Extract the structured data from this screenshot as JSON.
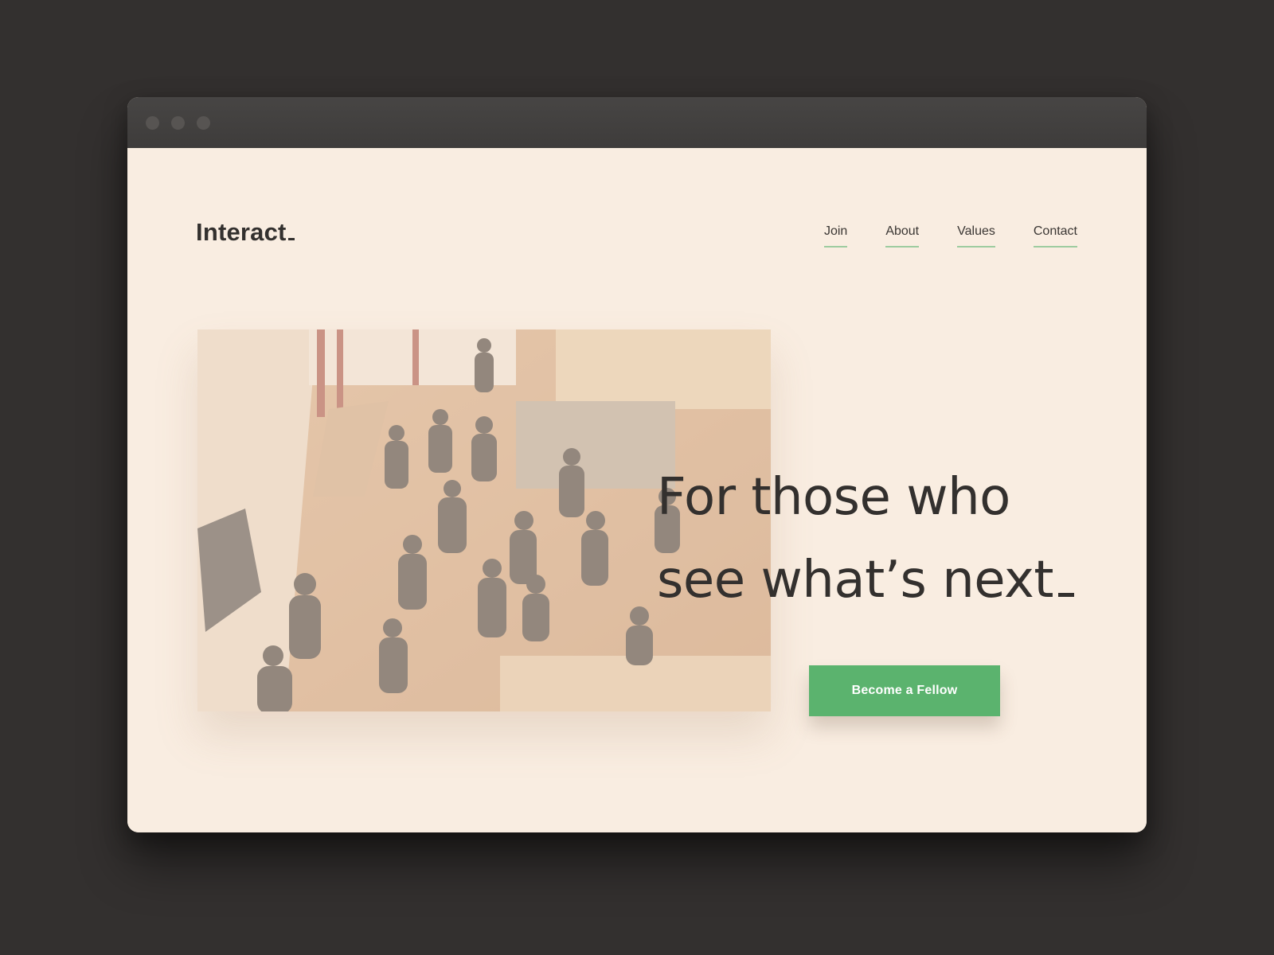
{
  "site": {
    "logo_text": "Interact",
    "nav": {
      "items": [
        {
          "label": "Join"
        },
        {
          "label": "About"
        },
        {
          "label": "Values"
        },
        {
          "label": "Contact"
        }
      ]
    }
  },
  "hero": {
    "headline_line1": "For those who",
    "headline_line2": "see what’s next",
    "cta_label": "Become a Fellow",
    "image_alt": "Overhead view of people mingling at a gathering in a bright apartment"
  },
  "colors": {
    "page_background": "#f9ede1",
    "accent_green": "#5bb36e",
    "nav_underline": "#9dcc9f",
    "text_dark": "#33302e",
    "desktop_background": "#33302f",
    "titlebar": "#434140"
  }
}
